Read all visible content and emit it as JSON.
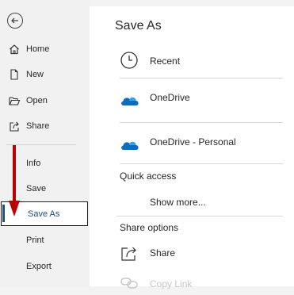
{
  "sidebar": {
    "items": [
      {
        "label": "Home",
        "icon": "home-icon"
      },
      {
        "label": "New",
        "icon": "new-document-icon"
      },
      {
        "label": "Open",
        "icon": "folder-open-icon"
      },
      {
        "label": "Share",
        "icon": "share-icon"
      },
      {
        "label": "Info"
      },
      {
        "label": "Save"
      },
      {
        "label": "Save As"
      },
      {
        "label": "Print"
      },
      {
        "label": "Export"
      }
    ],
    "selected": "Save As"
  },
  "main": {
    "title": "Save As",
    "locations": [
      {
        "label": "Recent",
        "icon": "clock-icon"
      },
      {
        "label": "OneDrive",
        "icon": "onedrive-cloud-icon"
      },
      {
        "label": "OneDrive - Personal",
        "icon": "onedrive-cloud-icon"
      }
    ],
    "quick_access": {
      "heading": "Quick access",
      "show_more": "Show more..."
    },
    "share_options": {
      "heading": "Share options",
      "items": [
        {
          "label": "Share",
          "icon": "share-icon"
        },
        {
          "label": "Copy Link",
          "icon": "link-icon"
        }
      ]
    }
  },
  "colors": {
    "accent": "#1e4e79",
    "annotation_arrow": "#c00000",
    "cloud": "#0f6cbd"
  }
}
